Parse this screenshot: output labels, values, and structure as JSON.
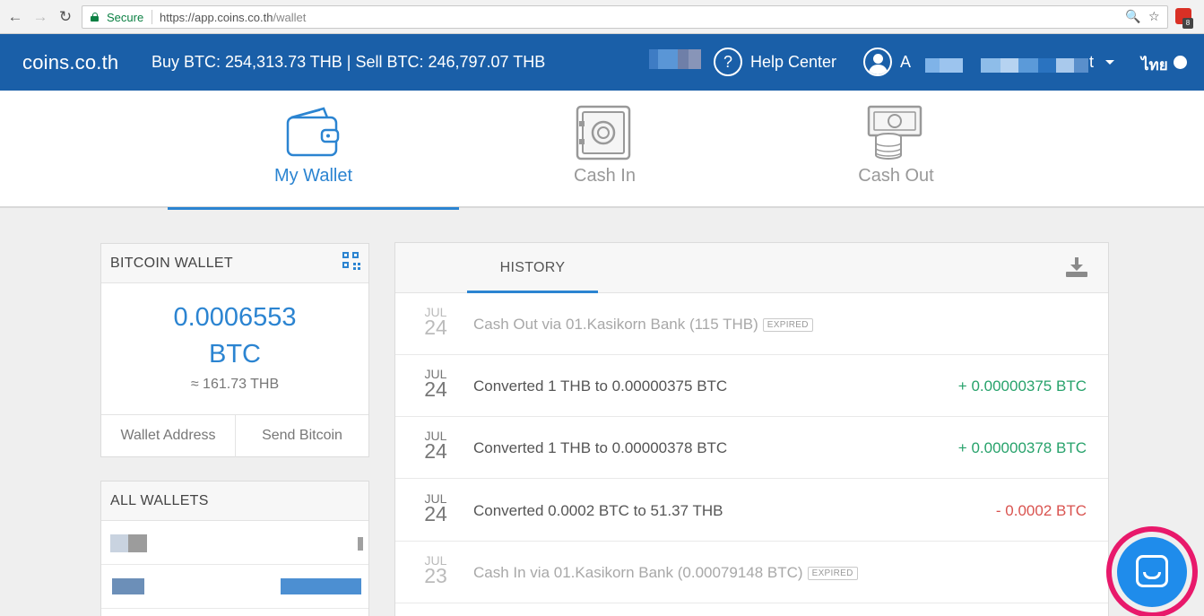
{
  "browser": {
    "secure_label": "Secure",
    "url_base": "https://app.coins.co.th",
    "url_path": "/wallet",
    "ext_badge": "8"
  },
  "header": {
    "logo": "coins.co.th",
    "prices": "Buy BTC: 254,313.73 THB | Sell BTC: 246,797.07 THB",
    "help_label": "Help Center",
    "user_initial": "A",
    "user_tail": "t",
    "lang": "ไทย"
  },
  "tabs": [
    {
      "label": "My Wallet",
      "icon": "wallet-icon",
      "active": true
    },
    {
      "label": "Cash In",
      "icon": "safe-icon",
      "active": false
    },
    {
      "label": "Cash Out",
      "icon": "cash-stack-icon",
      "active": false
    }
  ],
  "bitcoin_wallet": {
    "title": "BITCOIN WALLET",
    "amount": "0.0006553",
    "unit": "BTC",
    "thb_equivalent": "≈ 161.73 THB",
    "address_label": "Wallet Address",
    "send_label": "Send Bitcoin"
  },
  "all_wallets": {
    "title": "ALL WALLETS"
  },
  "history": {
    "tab_label": "HISTORY",
    "rows": [
      {
        "month": "JUL",
        "day": "24",
        "desc": "Cash Out via 01.Kasikorn Bank (115 THB)",
        "badge": "EXPIRED",
        "amount": "",
        "faded": true
      },
      {
        "month": "JUL",
        "day": "24",
        "desc": "Converted 1 THB to 0.00000375 BTC",
        "badge": "",
        "amount": "+ 0.00000375 BTC",
        "faded": false
      },
      {
        "month": "JUL",
        "day": "24",
        "desc": "Converted 1 THB to 0.00000378 BTC",
        "badge": "",
        "amount": "+ 0.00000378 BTC",
        "faded": false
      },
      {
        "month": "JUL",
        "day": "24",
        "desc": "Converted 0.0002 BTC to 51.37 THB",
        "badge": "",
        "amount": "- 0.0002 BTC",
        "faded": false
      },
      {
        "month": "JUL",
        "day": "23",
        "desc": "Cash In via 01.Kasikorn Bank (0.00079148 BTC)",
        "badge": "EXPIRED",
        "amount": "",
        "faded": true
      }
    ]
  },
  "colors": {
    "brand_blue": "#1a5fa8",
    "accent_blue": "#2b84d1",
    "positive": "#27a26b",
    "negative": "#d9534f",
    "chat_highlight": "#e8196b"
  }
}
